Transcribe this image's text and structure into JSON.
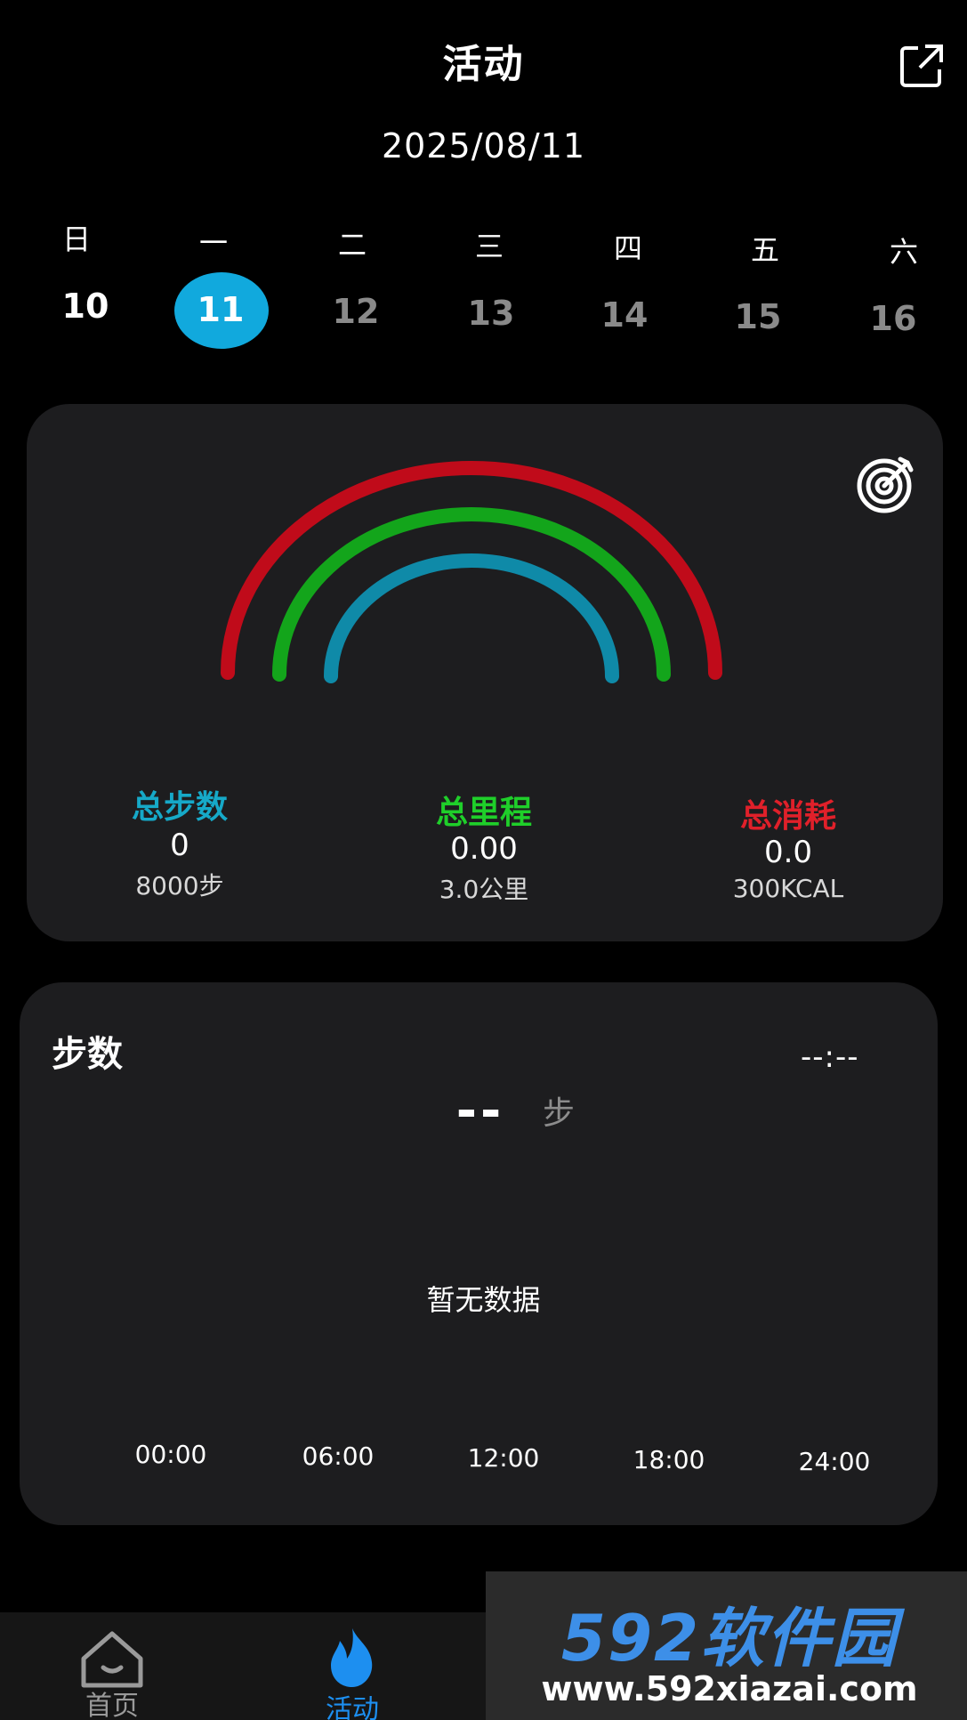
{
  "header": {
    "title": "活动",
    "date": "2025/08/11"
  },
  "calendar": {
    "weekdays": [
      "日",
      "一",
      "二",
      "三",
      "四",
      "五",
      "六"
    ],
    "days": [
      "10",
      "11",
      "12",
      "13",
      "14",
      "15",
      "16"
    ],
    "selected_day": "11"
  },
  "summary": {
    "steps_label": "总步数",
    "steps_value": "0",
    "steps_goal": "8000步",
    "distance_label": "总里程",
    "distance_value": "0.00",
    "distance_goal": "3.0公里",
    "calories_label": "总消耗",
    "calories_value": "0.0",
    "calories_goal": "300KCAL",
    "progress": {
      "steps": 0,
      "distance": 0,
      "calories": 0
    }
  },
  "steps_panel": {
    "title": "步数",
    "time": "--:--",
    "value": "--",
    "unit": "步",
    "empty_text": "暂无数据",
    "x_ticks": [
      "00:00",
      "06:00",
      "12:00",
      "18:00",
      "24:00"
    ]
  },
  "nav": {
    "home_label": "首页",
    "activity_label": "活动"
  },
  "watermark": {
    "logo": "592软件园",
    "url": "www.592xiazai.com"
  },
  "colors": {
    "accent": "#11a9dd",
    "steps": "#16a9c8",
    "distance": "#1fcf2a",
    "calories": "#e0202a",
    "card": "#1d1d1f"
  }
}
